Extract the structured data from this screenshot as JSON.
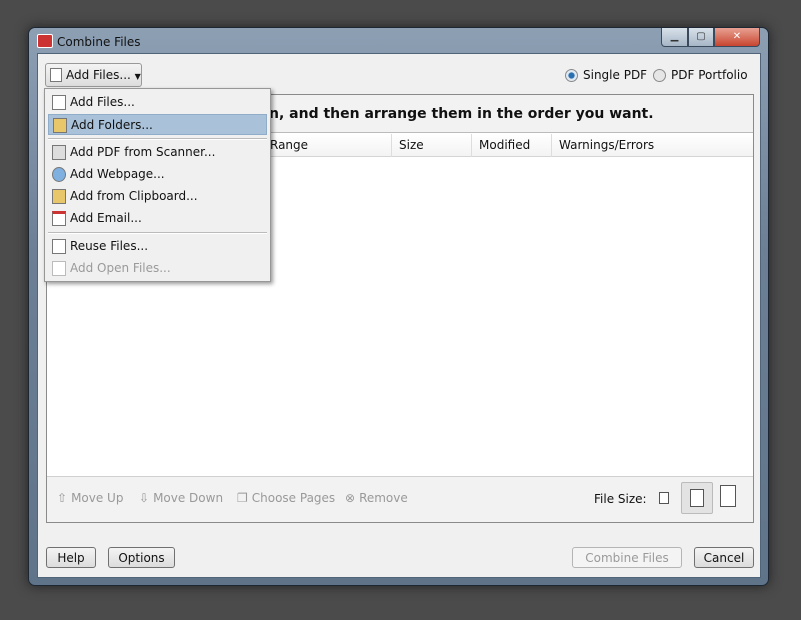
{
  "window": {
    "title": "Combine Files"
  },
  "toolbar": {
    "add_files": "Add Files..."
  },
  "output_type": {
    "options": [
      "Single PDF",
      "PDF Portfolio"
    ],
    "selected": "Single PDF"
  },
  "instruction": "n, and then arrange them in the order you want.",
  "columns": [
    "Range",
    "Size",
    "Modified",
    "Warnings/Errors"
  ],
  "menu": {
    "items": [
      {
        "label": "Add Files...",
        "icon": "add-file-icon",
        "state": "normal"
      },
      {
        "label": "Add Folders...",
        "icon": "add-folder-icon",
        "state": "highlighted"
      },
      {
        "label": "Add PDF from Scanner...",
        "icon": "scanner-icon",
        "state": "normal"
      },
      {
        "label": "Add Webpage...",
        "icon": "globe-icon",
        "state": "normal"
      },
      {
        "label": "Add from Clipboard...",
        "icon": "clipboard-icon",
        "state": "normal"
      },
      {
        "label": "Add Email...",
        "icon": "email-icon",
        "state": "normal"
      },
      {
        "label": "Reuse Files...",
        "icon": "reuse-icon",
        "state": "normal"
      },
      {
        "label": "Add Open Files...",
        "icon": "open-files-icon",
        "state": "disabled"
      }
    ]
  },
  "list_toolbar": {
    "move_up": "Move Up",
    "move_down": "Move Down",
    "choose_pages": "Choose Pages",
    "remove": "Remove",
    "file_size": "File Size:",
    "file_size_selected": "medium"
  },
  "footer": {
    "help": "Help",
    "options": "Options",
    "combine": "Combine Files",
    "cancel": "Cancel"
  }
}
